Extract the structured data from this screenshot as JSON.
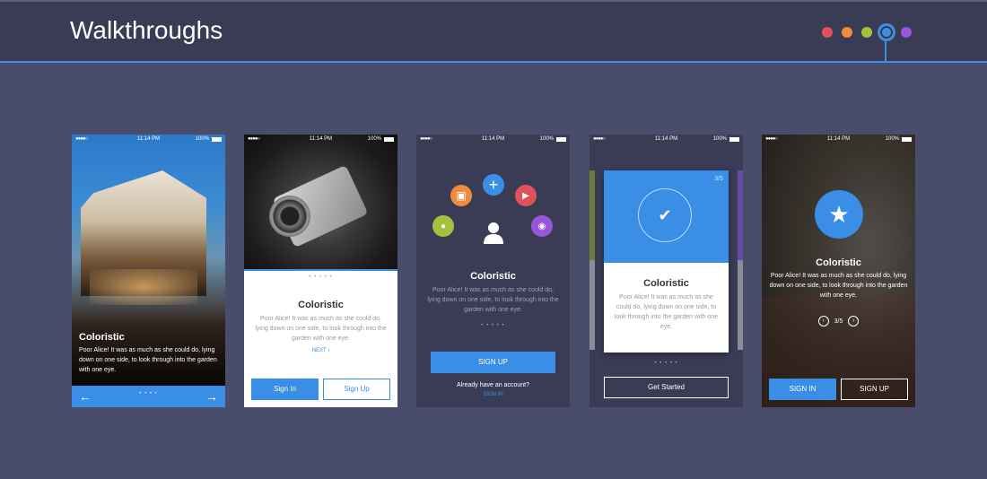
{
  "header": {
    "title": "Walkthroughs",
    "dots": [
      "#e0525a",
      "#f08a3c",
      "#a8c03a",
      "#3e8fe0",
      "#9a56d8"
    ],
    "accent": "#3e8fe0"
  },
  "status": {
    "time": "11:14 PM",
    "battery": "100%",
    "signal": "●●●●○"
  },
  "common": {
    "title": "Coloristic",
    "body": "Poor Alice! It was as much as she could do, lying down on one side, to look through into the garden with one eye."
  },
  "phone1": {
    "left_arrow": "←",
    "right_arrow": "→",
    "pager": "• • • •"
  },
  "phone2": {
    "pager": "• • • • •",
    "next": "NEXT ›",
    "sign_in": "Sign In",
    "sign_up": "Sign Up"
  },
  "phone3": {
    "icons": [
      "image-icon",
      "plus-icon",
      "video-icon",
      "chat-icon",
      "location-icon",
      "user-icon"
    ],
    "pager": "• • • • •",
    "sign_up": "SIGN UP",
    "have_account": "Already have an account?",
    "sign_in": "SIGN IN"
  },
  "phone4": {
    "counter": "3/5",
    "pager": "• • • • •",
    "get_started": "Get Started"
  },
  "phone5": {
    "counter": "3/5",
    "prev": "‹",
    "next": "›",
    "sign_in": "SIGN IN",
    "sign_up": "SIGN UP"
  }
}
